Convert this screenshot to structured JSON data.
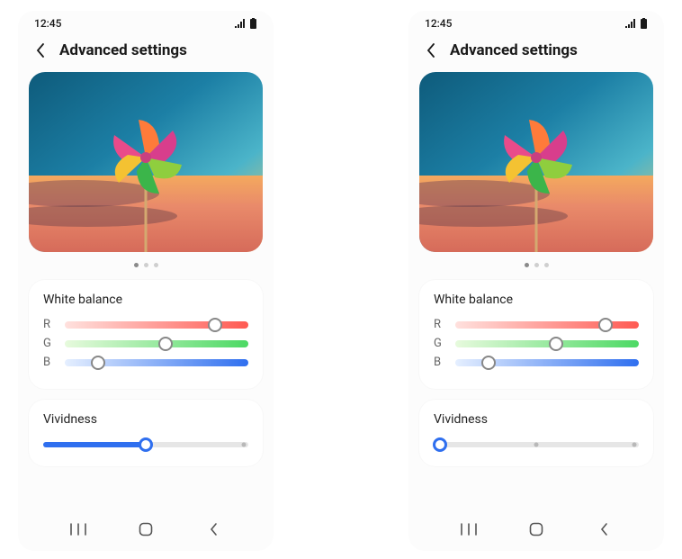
{
  "status": {
    "time": "12:45"
  },
  "header": {
    "title": "Advanced settings"
  },
  "white_balance": {
    "title": "White balance",
    "labels": {
      "r": "R",
      "g": "G",
      "b": "B"
    },
    "values": {
      "r": 82,
      "g": 55,
      "b": 18
    }
  },
  "vividness": {
    "title": "Vividness",
    "left_value": 50,
    "right_value": 0,
    "ticks": [
      50,
      100
    ]
  },
  "dots": {
    "active": 0,
    "count": 3
  }
}
